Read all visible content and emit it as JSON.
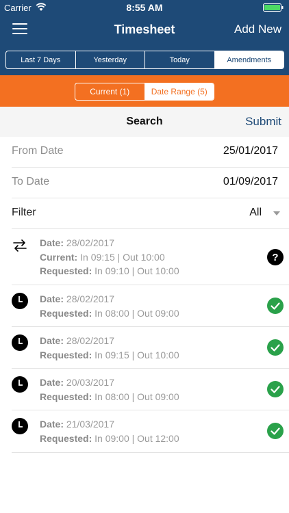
{
  "status_bar": {
    "carrier": "Carrier",
    "time": "8:55 AM"
  },
  "nav": {
    "title": "Timesheet",
    "add_new": "Add New"
  },
  "tabs": [
    {
      "label": "Last 7 Days"
    },
    {
      "label": "Yesterday"
    },
    {
      "label": "Today"
    },
    {
      "label": "Amendments",
      "active": true
    }
  ],
  "segments": {
    "current": "Current (1)",
    "date_range": "Date Range (5)",
    "selected": "date_range"
  },
  "search_bar": {
    "label": "Search",
    "submit": "Submit"
  },
  "form": {
    "from_label": "From Date",
    "from_value": "25/01/2017",
    "to_label": "To Date",
    "to_value": "01/09/2017",
    "filter_label": "Filter",
    "filter_value": "All"
  },
  "labels": {
    "date": "Date:",
    "current": "Current:",
    "requested": "Requested:"
  },
  "amendments": [
    {
      "icon": "swap-arrows-icon",
      "date": " 28/02/2017",
      "current": " In 09:15 | Out 10:00",
      "requested": " In 09:10 | Out 10:00",
      "status": "pending"
    },
    {
      "icon": "clock-icon",
      "date": " 28/02/2017",
      "requested": " In 08:00 | Out 09:00",
      "status": "approved"
    },
    {
      "icon": "clock-icon",
      "date": " 28/02/2017",
      "requested": " In 09:15 | Out 10:00",
      "status": "approved"
    },
    {
      "icon": "clock-icon",
      "date": " 20/03/2017",
      "requested": " In 08:00 | Out 09:00",
      "status": "approved"
    },
    {
      "icon": "clock-icon",
      "date": " 21/03/2017",
      "requested": " In 09:00 | Out 12:00",
      "status": "approved"
    }
  ],
  "colors": {
    "nav": "#1e4a77",
    "accent": "#f37021",
    "approved": "#2aa14a",
    "pending": "#000000"
  }
}
